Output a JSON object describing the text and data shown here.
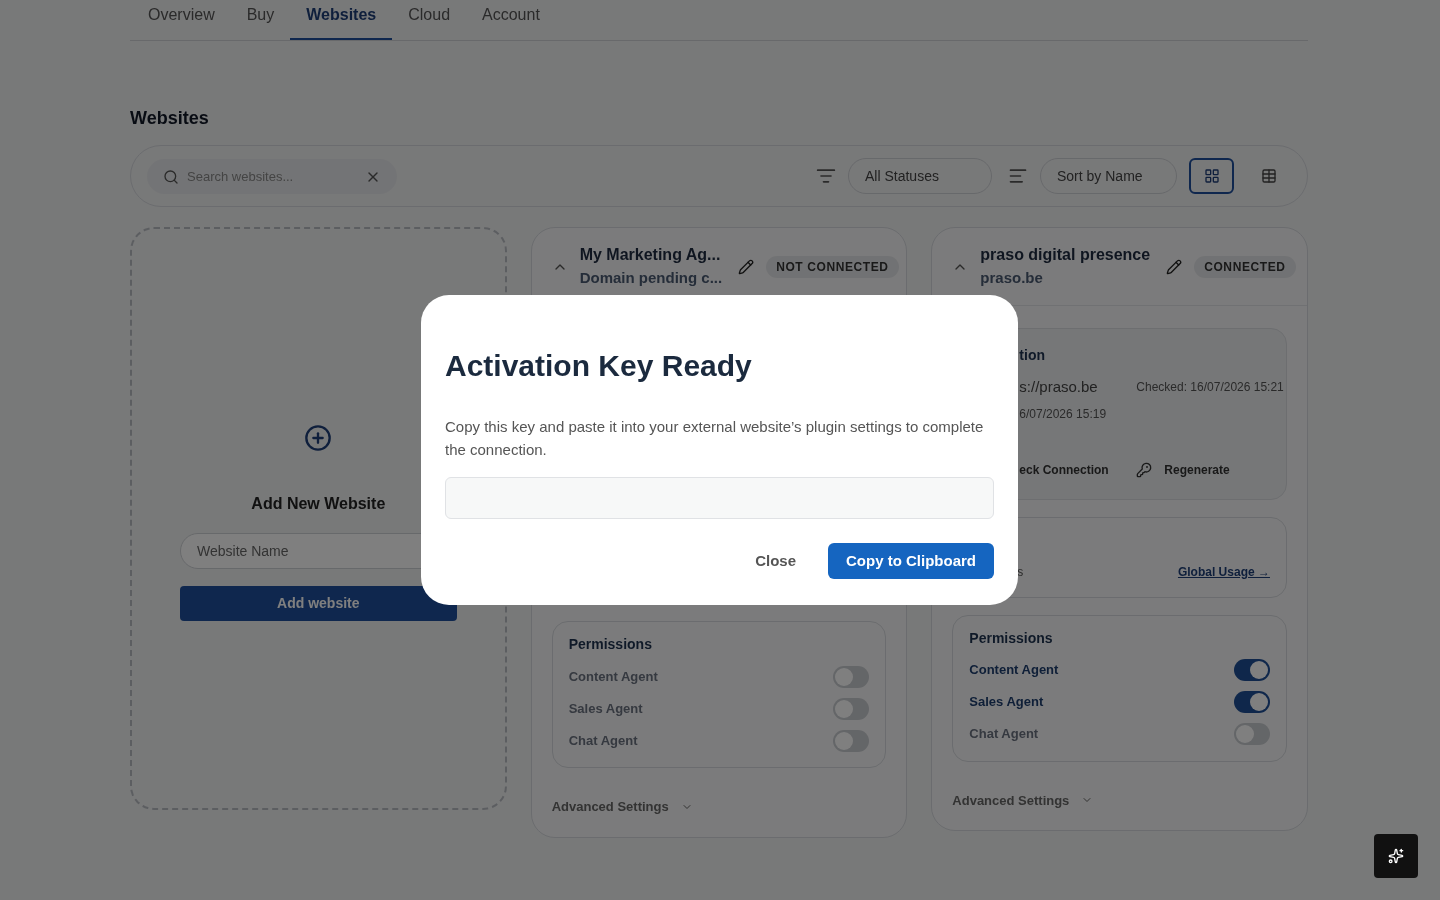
{
  "tabs": [
    {
      "label": "Overview",
      "selected": false
    },
    {
      "label": "Buy",
      "selected": false
    },
    {
      "label": "Websites",
      "selected": true
    },
    {
      "label": "Cloud",
      "selected": false
    },
    {
      "label": "Account",
      "selected": false
    }
  ],
  "page_title": "Websites",
  "toolbar": {
    "search_placeholder": "Search websites...",
    "status_filter": "All Statuses",
    "sort": "Sort by Name"
  },
  "view_toggle": [
    {
      "kind": "grid",
      "selected": true
    },
    {
      "kind": "list",
      "selected": false
    }
  ],
  "add_card": {
    "title": "Add New Website",
    "name_placeholder": "Website Name",
    "button": "Add website"
  },
  "sites": [
    {
      "title": "My Marketing Ag...",
      "subtitle": "Domain pending c...",
      "status": "NOT CONNECTED",
      "permissions_title": "Permissions",
      "permissions": [
        {
          "label": "Content Agent",
          "on": false
        },
        {
          "label": "Sales Agent",
          "on": false
        },
        {
          "label": "Chat Agent",
          "on": false
        }
      ],
      "advanced": "Advanced Settings"
    },
    {
      "title": "praso digital presence",
      "subtitle": "praso.be",
      "status": "CONNECTED",
      "connection": {
        "heading": "tion",
        "url": "s://praso.be",
        "checked": "Checked: 16/07/2026 15:21",
        "date": "6/07/2026 15:19",
        "check": "eck Connection",
        "regenerate": "Regenerate"
      },
      "usage": {
        "label": "s",
        "link": "Global Usage →"
      },
      "permissions_title": "Permissions",
      "permissions": [
        {
          "label": "Content Agent",
          "on": true
        },
        {
          "label": "Sales Agent",
          "on": true
        },
        {
          "label": "Chat Agent",
          "on": false
        }
      ],
      "advanced": "Advanced Settings"
    }
  ],
  "modal": {
    "title": "Activation Key Ready",
    "text": "Copy this key and paste it into your external website’s plugin settings to complete the connection.",
    "close": "Close",
    "confirm": "Copy to Clipboard"
  }
}
